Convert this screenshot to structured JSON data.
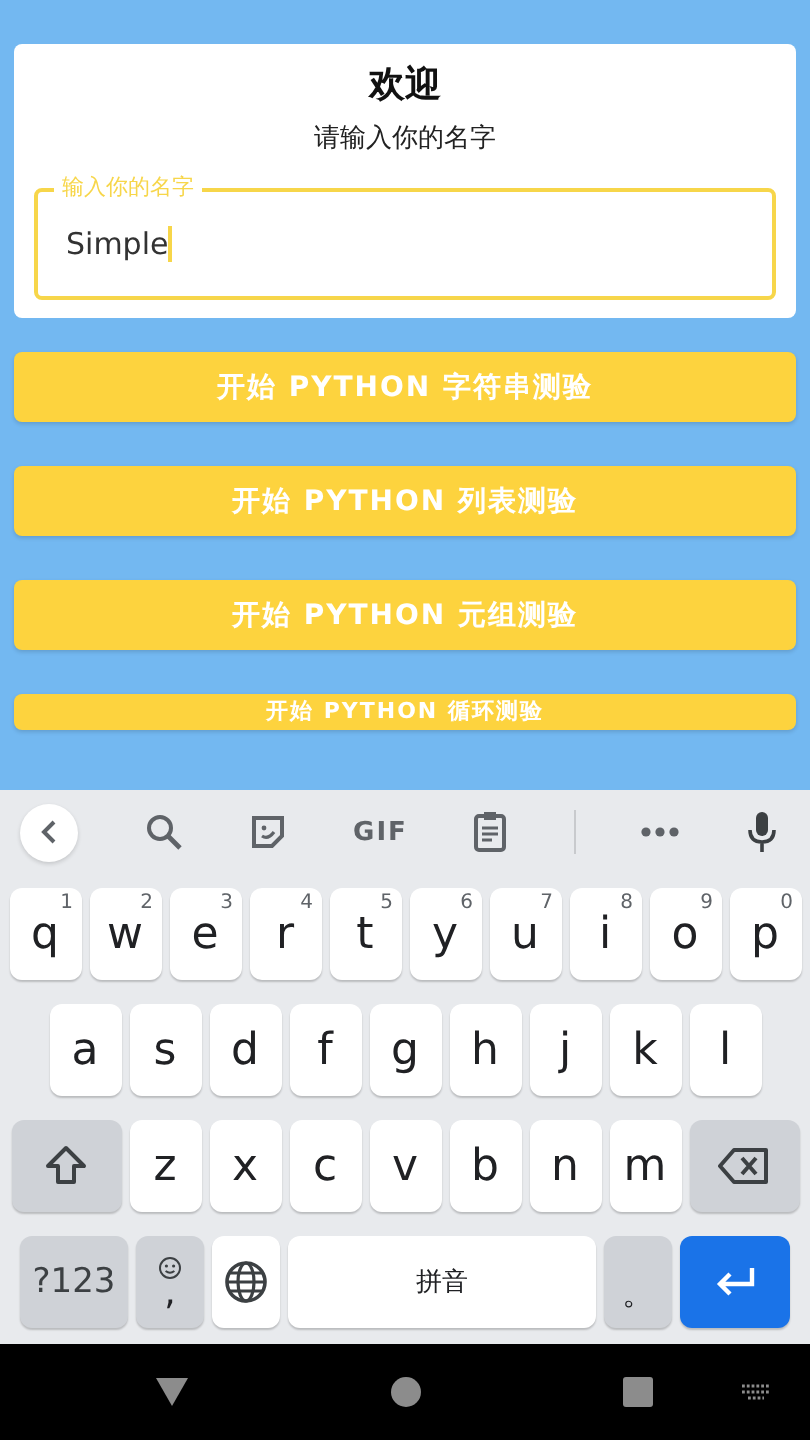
{
  "card": {
    "title": "欢迎",
    "subtitle": "请输入你的名字",
    "field": {
      "label": "输入你的名字",
      "value": "Simple",
      "focused": true
    }
  },
  "buttons": [
    {
      "label": "开始 PYTHON 字符串测验",
      "clipped": false
    },
    {
      "label": "开始 PYTHON 列表测验",
      "clipped": false
    },
    {
      "label": "开始 PYTHON 元组测验",
      "clipped": false
    },
    {
      "label": "开始 PYTHON 循环测验",
      "clipped": true
    }
  ],
  "keyboard": {
    "toolbar": [
      {
        "kind": "back"
      },
      {
        "kind": "search"
      },
      {
        "kind": "sticker"
      },
      {
        "kind": "gif",
        "label": "GIF"
      },
      {
        "kind": "clipboard"
      },
      {
        "kind": "divider"
      },
      {
        "kind": "more"
      },
      {
        "kind": "mic"
      }
    ],
    "rows": [
      {
        "keys": [
          {
            "kind": "letter",
            "label": "q",
            "hint": "1"
          },
          {
            "kind": "letter",
            "label": "w",
            "hint": "2"
          },
          {
            "kind": "letter",
            "label": "e",
            "hint": "3"
          },
          {
            "kind": "letter",
            "label": "r",
            "hint": "4"
          },
          {
            "kind": "letter",
            "label": "t",
            "hint": "5"
          },
          {
            "kind": "letter",
            "label": "y",
            "hint": "6"
          },
          {
            "kind": "letter",
            "label": "u",
            "hint": "7"
          },
          {
            "kind": "letter",
            "label": "i",
            "hint": "8"
          },
          {
            "kind": "letter",
            "label": "o",
            "hint": "9"
          },
          {
            "kind": "letter",
            "label": "p",
            "hint": "0"
          }
        ]
      },
      {
        "keys": [
          {
            "kind": "letter",
            "label": "a"
          },
          {
            "kind": "letter",
            "label": "s"
          },
          {
            "kind": "letter",
            "label": "d"
          },
          {
            "kind": "letter",
            "label": "f"
          },
          {
            "kind": "letter",
            "label": "g"
          },
          {
            "kind": "letter",
            "label": "h"
          },
          {
            "kind": "letter",
            "label": "j"
          },
          {
            "kind": "letter",
            "label": "k"
          },
          {
            "kind": "letter",
            "label": "l"
          }
        ]
      },
      {
        "keys": [
          {
            "kind": "shift"
          },
          {
            "kind": "letter",
            "label": "z"
          },
          {
            "kind": "letter",
            "label": "x"
          },
          {
            "kind": "letter",
            "label": "c"
          },
          {
            "kind": "letter",
            "label": "v"
          },
          {
            "kind": "letter",
            "label": "b"
          },
          {
            "kind": "letter",
            "label": "n"
          },
          {
            "kind": "letter",
            "label": "m"
          },
          {
            "kind": "backspace"
          }
        ]
      },
      {
        "keys": [
          {
            "kind": "symbols",
            "label": "?123"
          },
          {
            "kind": "comma",
            "label": ","
          },
          {
            "kind": "globe"
          },
          {
            "kind": "space",
            "label": "拼音"
          },
          {
            "kind": "period",
            "label": "。"
          },
          {
            "kind": "enter"
          }
        ]
      }
    ]
  },
  "nav_bar": [
    {
      "kind": "back"
    },
    {
      "kind": "home"
    },
    {
      "kind": "recents"
    },
    {
      "kind": "keyboard"
    }
  ]
}
